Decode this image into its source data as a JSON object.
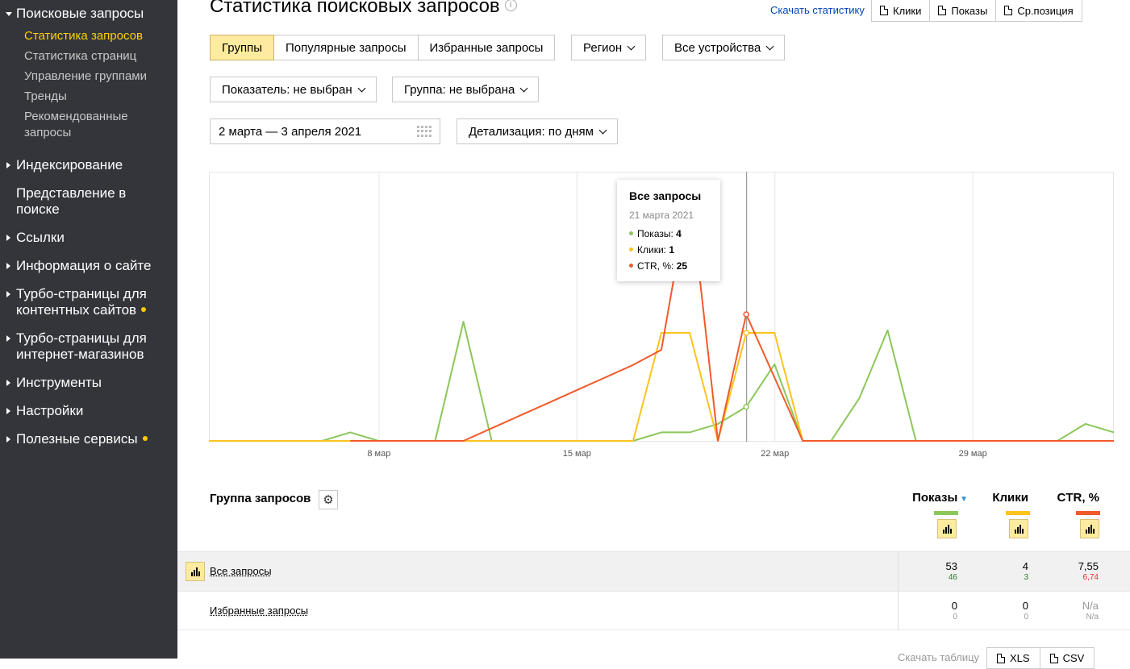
{
  "sidebar": {
    "sections": [
      {
        "label": "Поисковые запросы",
        "expanded": true,
        "items": [
          "Статистика запросов",
          "Статистика страниц",
          "Управление группами",
          "Тренды",
          "Рекомендованные запросы"
        ],
        "active_item": 0
      },
      {
        "label": "Индексирование",
        "expanded": false
      },
      {
        "label": "Представление в поиске",
        "expanded": null
      },
      {
        "label": "Ссылки",
        "expanded": false
      },
      {
        "label": "Информация о сайте",
        "expanded": false
      },
      {
        "label": "Турбо-страницы для контентных сайтов",
        "expanded": false,
        "dot": true
      },
      {
        "label": "Турбо-страницы для интернет-магазинов",
        "expanded": false
      },
      {
        "label": "Инструменты",
        "expanded": false
      },
      {
        "label": "Настройки",
        "expanded": false
      },
      {
        "label": "Полезные сервисы",
        "expanded": false,
        "dot": true
      }
    ]
  },
  "header": {
    "title": "Статистика поисковых запросов",
    "info_icon": "i",
    "download_link": "Скачать статистику",
    "downloads": [
      "Клики",
      "Показы",
      "Ср.позиция"
    ]
  },
  "tabs": {
    "items": [
      "Группы",
      "Популярные запросы",
      "Избранные запросы"
    ],
    "active": 0
  },
  "filters": {
    "region": "Регион",
    "devices": "Все устройства",
    "metric": "Показатель: не выбран",
    "group": "Группа: не выбрана",
    "date_range": "2 марта — 3 апреля 2021",
    "detail": "Детализация: по дням"
  },
  "chart_data": {
    "type": "line",
    "x_ticks": [
      "8 мар",
      "15 мар",
      "22 мар",
      "29 мар"
    ],
    "x": [
      "2 мар",
      "3 мар",
      "4 мар",
      "5 мар",
      "6 мар",
      "7 мар",
      "8 мар",
      "9 мар",
      "10 мар",
      "11 мар",
      "12 мар",
      "13 мар",
      "14 мар",
      "15 мар",
      "16 мар",
      "17 мар",
      "18 мар",
      "19 мар",
      "20 мар",
      "21 мар",
      "22 мар",
      "23 мар",
      "24 мар",
      "25 мар",
      "26 мар",
      "27 мар",
      "28 мар",
      "29 мар",
      "30 мар",
      "31 мар",
      "1 апр",
      "2 апр",
      "3 апр"
    ],
    "series": [
      {
        "name": "Показы",
        "color": "#8cc75a",
        "values": [
          0,
          0,
          0,
          0,
          0,
          1,
          0,
          0,
          0,
          14,
          0,
          0,
          0,
          0,
          0,
          0,
          1,
          1,
          2,
          4,
          9,
          0,
          0,
          5,
          13,
          0,
          0,
          0,
          0,
          0,
          0,
          2,
          1
        ]
      },
      {
        "name": "Клики",
        "color": "#ffc31f",
        "values": [
          0,
          0,
          0,
          0,
          0,
          0,
          0,
          0,
          0,
          0,
          0,
          0,
          0,
          0,
          0,
          0,
          1,
          1,
          0,
          1,
          1,
          0,
          0,
          0,
          0,
          0,
          0,
          0,
          0,
          0,
          0,
          0,
          0
        ]
      },
      {
        "name": "CTR, %",
        "color": "#f15a2b",
        "values": [
          null,
          null,
          null,
          null,
          null,
          0,
          0,
          0,
          0,
          0,
          5,
          10,
          15,
          20,
          25,
          30,
          36,
          100,
          0,
          50,
          25,
          0,
          0,
          0,
          0,
          0,
          0,
          0,
          0,
          0,
          0,
          0,
          0
        ]
      }
    ],
    "hover_index": 19,
    "tooltip": {
      "title": "Все запросы",
      "date": "21 марта 2021",
      "rows": [
        {
          "label": "Показы:",
          "value": "4",
          "color": "#8cc75a"
        },
        {
          "label": "Клики:",
          "value": "1",
          "color": "#ffc31f"
        },
        {
          "label": "CTR, %:",
          "value": "25",
          "color": "#f15a2b"
        }
      ]
    }
  },
  "table": {
    "group_label": "Группа запросов",
    "columns": [
      {
        "label": "Показы",
        "color": "#8cc75a",
        "sorted": true
      },
      {
        "label": "Клики",
        "color": "#ffc31f"
      },
      {
        "label": "CTR, %",
        "color": "#f15a2b"
      }
    ],
    "rows": [
      {
        "name": "Все запросы",
        "shows": "53",
        "shows_prev": "46",
        "clicks": "4",
        "clicks_prev": "3",
        "ctr": "7,55",
        "ctr_prev": "6,74"
      },
      {
        "name": "Избранные запросы",
        "shows": "0",
        "shows_prev": "0",
        "clicks": "0",
        "clicks_prev": "0",
        "ctr": "N/a",
        "ctr_prev": "N/a"
      }
    ],
    "download_label": "Скачать таблицу",
    "formats": [
      "XLS",
      "CSV"
    ]
  }
}
